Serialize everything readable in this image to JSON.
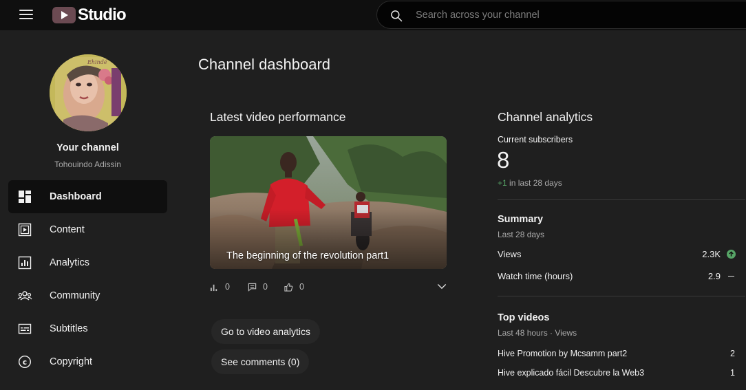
{
  "header": {
    "logo_text": "Studio",
    "search_placeholder": "Search across your channel"
  },
  "sidebar": {
    "channel_title": "Your channel",
    "channel_name": "Tohouindo Adissin",
    "items": [
      {
        "label": "Dashboard",
        "icon": "dashboard-icon",
        "active": true
      },
      {
        "label": "Content",
        "icon": "content-icon"
      },
      {
        "label": "Analytics",
        "icon": "analytics-icon"
      },
      {
        "label": "Community",
        "icon": "community-icon"
      },
      {
        "label": "Subtitles",
        "icon": "subtitles-icon"
      },
      {
        "label": "Copyright",
        "icon": "copyright-icon"
      }
    ]
  },
  "main": {
    "page_title": "Channel dashboard",
    "latest_video": {
      "title": "Latest video performance",
      "video_title": "The beginning of the revolution part1",
      "views": "0",
      "comments": "0",
      "likes": "0",
      "analytics_button": "Go to video analytics",
      "comments_button": "See comments (0)"
    },
    "analytics": {
      "title": "Channel analytics",
      "subscribers_label": "Current subscribers",
      "subscribers_count": "8",
      "subscribers_delta": "+1",
      "subscribers_delta_suffix": " in last 28 days",
      "summary_title": "Summary",
      "summary_period": "Last 28 days",
      "views_label": "Views",
      "views_value": "2.3K",
      "watch_label": "Watch time (hours)",
      "watch_value": "2.9",
      "top_title": "Top videos",
      "top_period": "Last 48 hours · Views",
      "top_videos": [
        {
          "title": "Hive Promotion by Mcsamm part2",
          "views": "2"
        },
        {
          "title": "Hive explicado fácil Descubre la Web3",
          "views": "1"
        }
      ]
    }
  },
  "colors": {
    "accent_green": "#57a567",
    "background": "#1f1f1f",
    "topbar": "#0f0f0f"
  }
}
